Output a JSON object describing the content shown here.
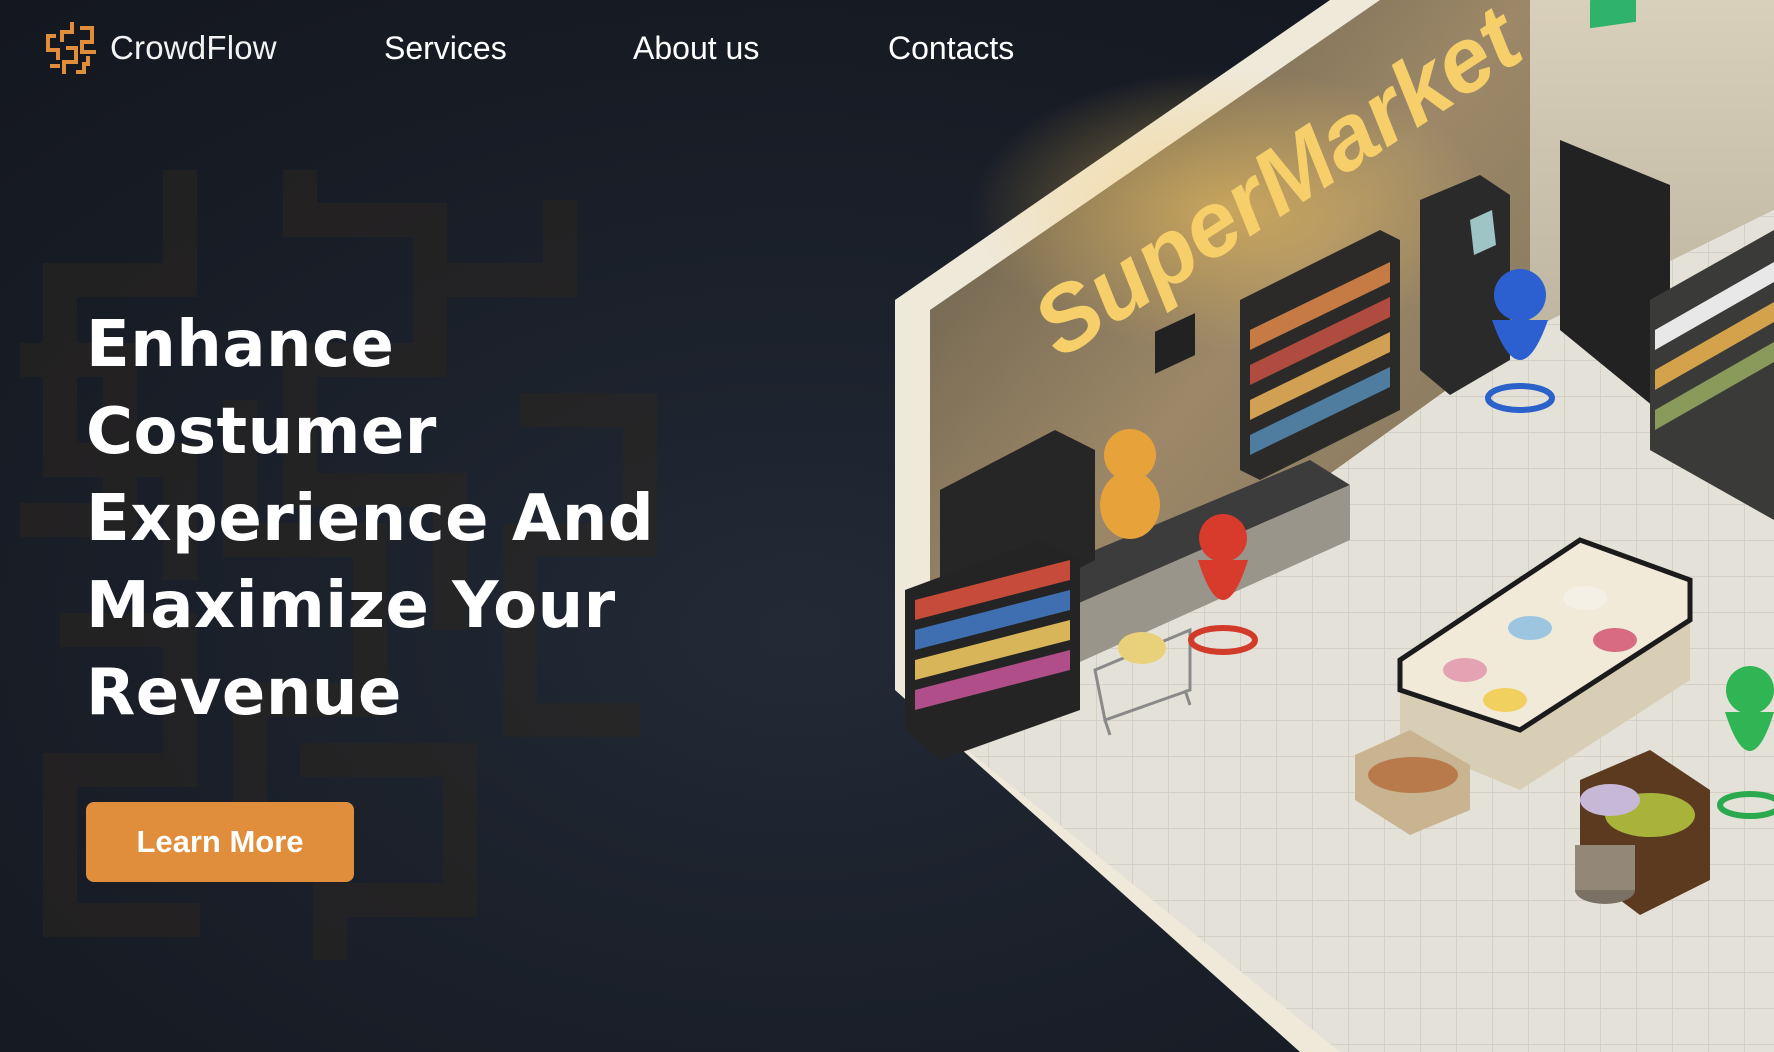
{
  "brand": {
    "name": "CrowdFlow",
    "accent_color": "#e08e3c",
    "logo_icon": "maze-icon"
  },
  "nav": {
    "items": [
      {
        "label": "Services"
      },
      {
        "label": "About us"
      },
      {
        "label": "Contacts"
      }
    ]
  },
  "hero": {
    "heading_lines": [
      "Enhance",
      "Costumer",
      "Experience And",
      "Maximize Your",
      "Revenue"
    ],
    "cta_label": "Learn More"
  },
  "illustration": {
    "store_sign": "SuperMarket",
    "description_icon": "supermarket-scene-icon"
  },
  "colors": {
    "background": "#1a1f29",
    "cta": "#e08e3c",
    "sign": "#f6cf6a"
  }
}
